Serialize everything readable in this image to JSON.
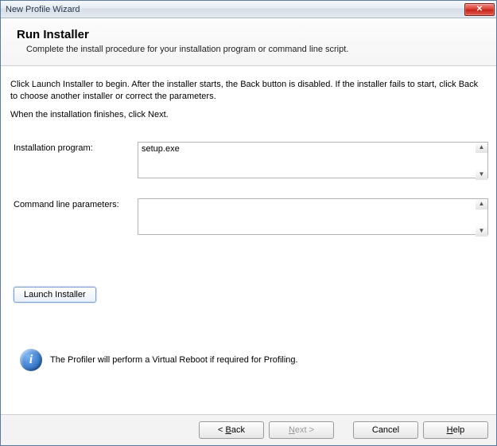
{
  "window": {
    "title": "New Profile Wizard"
  },
  "header": {
    "title": "Run Installer",
    "subtitle": "Complete the install procedure for your installation program or command line script."
  },
  "instructions": {
    "line1": "Click Launch Installer to begin. After the installer starts, the Back button is disabled. If the installer fails to start, click Back to choose another installer or correct the parameters.",
    "line2": "When the installation finishes, click Next."
  },
  "form": {
    "install_program_label": "Installation program:",
    "install_program_value": "setup.exe",
    "cmdline_label": "Command line parameters:",
    "cmdline_value": ""
  },
  "launch_button": "Launch Installer",
  "info_text": "The Profiler will perform a Virtual Reboot if required for Profiling.",
  "footer": {
    "back": "< Back",
    "next": "Next >",
    "cancel": "Cancel",
    "help": "Help"
  }
}
